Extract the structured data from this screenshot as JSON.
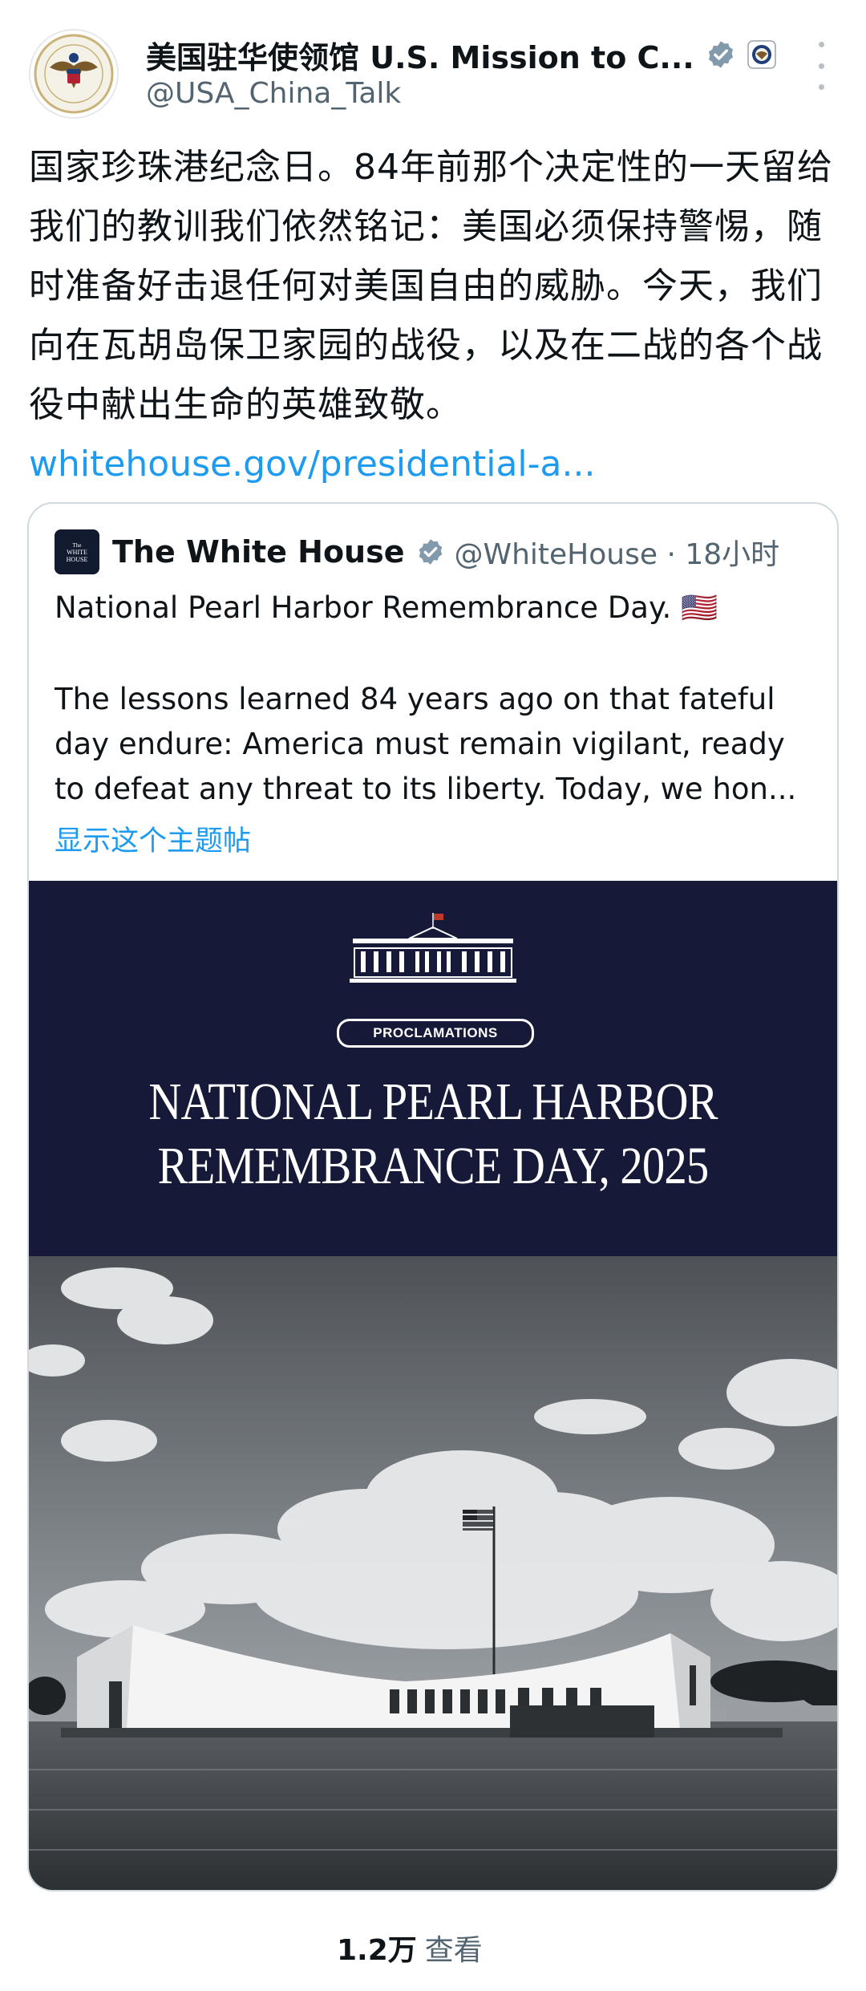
{
  "post": {
    "author_name": "美国驻华使领馆 U.S. Mission to C...",
    "author_handle": "@USA_China_Talk",
    "text": "国家珍珠港纪念日。84年前那个决定性的一天留给我们的教训我们依然铭记：美国必须保持警惕，随时准备好击退任何对美国自由的威胁。今天，我们向在瓦胡岛保卫家园的战役，以及在二战的各个战役中献出生命的英雄致敬。",
    "link_text": "whitehouse.gov/presidential-a..."
  },
  "quoted": {
    "author_name": "The White House",
    "author_handle": "@WhiteHouse · 18小时",
    "logo_text": "THE WHITE HOUSE",
    "line1": "National Pearl Harbor Remembrance Day. 🇺🇸",
    "body": "The lessons learned 84 years ago on that fateful day endure: America must remain vigilant, ready to defeat any threat to its liberty. Today, we hon...",
    "show_thread": "显示这个主题帖",
    "banner": {
      "pill": "PROCLAMATIONS",
      "title_line1": "NATIONAL PEARL HARBOR",
      "title_line2": "REMEMBRANCE DAY, 2025"
    }
  },
  "views": {
    "count": "1.2万",
    "label": "查看"
  },
  "colors": {
    "link": "#1d9bf0",
    "verified": "#829aab",
    "banner_bg": "#161a38"
  },
  "icons": [
    "avatar-seal-icon",
    "verified-badge-icon",
    "state-dept-seal-icon",
    "more-options-icon",
    "white-house-logo-icon",
    "us-flag-icon",
    "white-house-building-icon"
  ]
}
